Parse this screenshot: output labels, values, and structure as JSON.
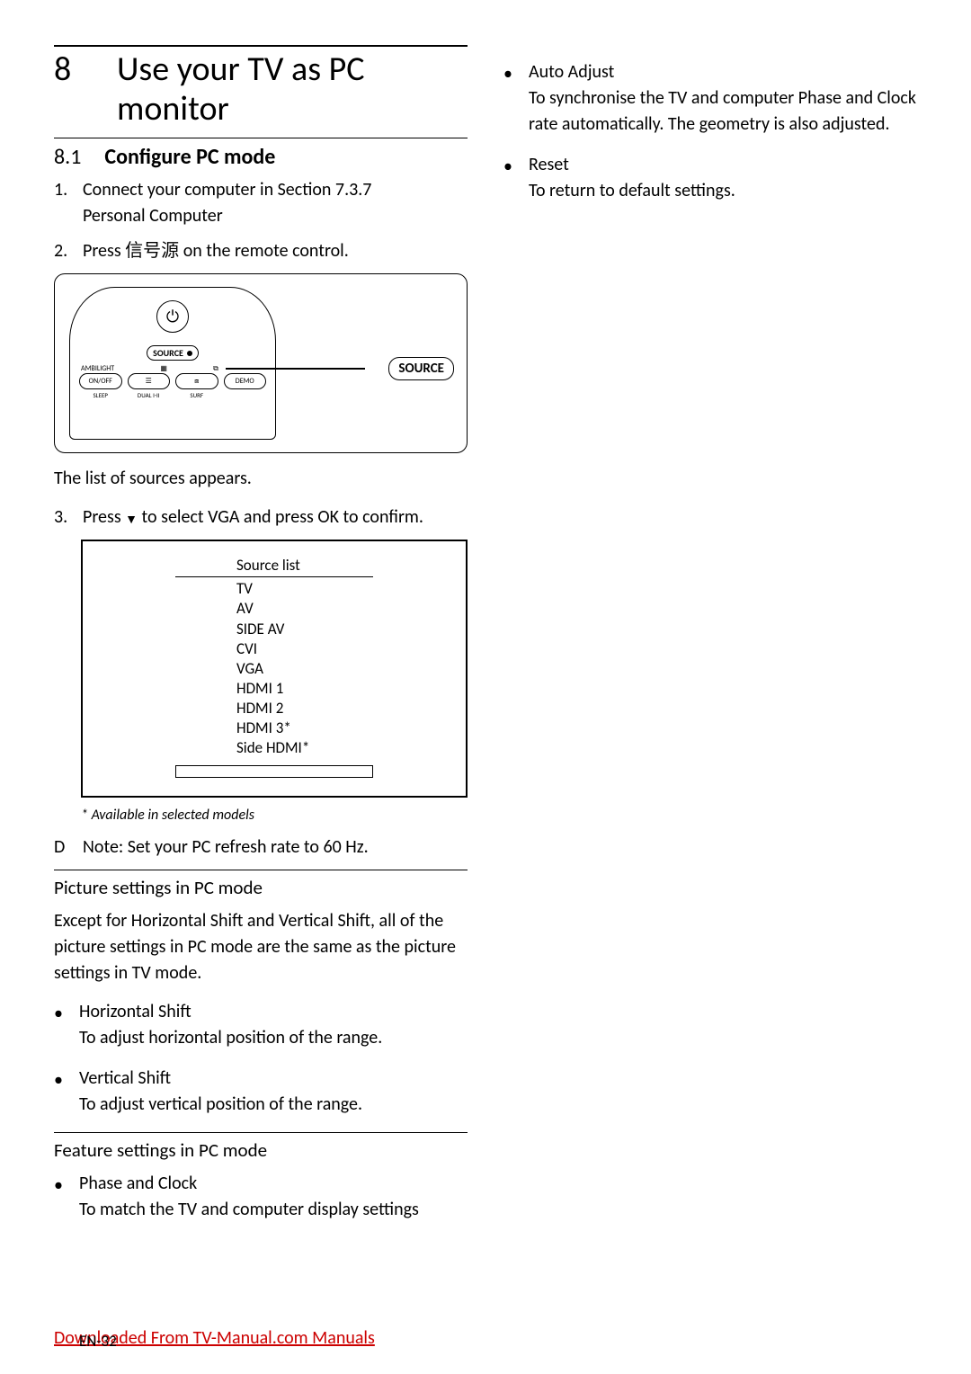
{
  "chapter": {
    "num": "8",
    "title": "Use your TV as PC monitor"
  },
  "section": {
    "num": "8.1",
    "title": "Configure PC mode"
  },
  "step1": {
    "num": "1.",
    "prefix": "Connect your computer in ",
    "secref": "Section 7.3.7",
    "suffix": "Personal Computer"
  },
  "step2": {
    "num": "2.",
    "prefix": "Press ",
    "cjk": "信号源",
    "suffix": " on the remote control."
  },
  "remote": {
    "source_pill": "SOURCE",
    "ambilight": "AMBILIGHT",
    "onoff": "ON/OFF",
    "demo": "DEMO",
    "sleep": "SLEEP",
    "dual": "DUAL I-II",
    "surf": "SURF",
    "callout": "SOURCE"
  },
  "after_remote": "The list of sources appears.",
  "step3": {
    "num": "3.",
    "prefix": "Press ",
    "mid": " to select VGA and press ",
    "ok": "OK",
    "end": " to confirm."
  },
  "sourcelist": {
    "title": "Source list",
    "items": [
      "TV",
      "AV",
      "SIDE AV",
      "CVI",
      "VGA",
      "HDMI 1",
      "HDMI 2",
      "HDMI 3*",
      "Side HDMI*"
    ]
  },
  "footnote": "* Available in selected models",
  "note": {
    "icon": "D",
    "label": "Note:",
    "text": " Set your PC refresh rate to 60 Hz."
  },
  "picture_heading": "Picture settings in PC mode",
  "picture_para": "Except for Horizontal Shift and Vertical Shift, all of the picture settings in PC mode are the same as the picture settings in TV mode.",
  "pic_bullets": {
    "hshift": {
      "term": "Horizontal Shift",
      "desc": "To adjust horizontal position of the range."
    },
    "vshift": {
      "term": "Vertical Shift",
      "desc": "To adjust vertical position of the range."
    }
  },
  "feature_heading": "Feature settings in PC mode",
  "feat_bullets": {
    "phaseclock": {
      "t1": "Phase",
      "and": " and ",
      "t2": "Clock",
      "desc": "To match the TV and computer display settings"
    },
    "autoadj": {
      "term": "Auto Adjust",
      "d1": "To synchronise the TV and computer Phase and ",
      "clock": "Clock",
      "d2": " rate automatically. The geometry is also adjusted."
    },
    "reset": {
      "term": "Reset",
      "desc": "To return to default settings."
    }
  },
  "footer": {
    "link": "Downloaded From TV-Manual.com Manuals",
    "pagenum": "EN-32"
  }
}
